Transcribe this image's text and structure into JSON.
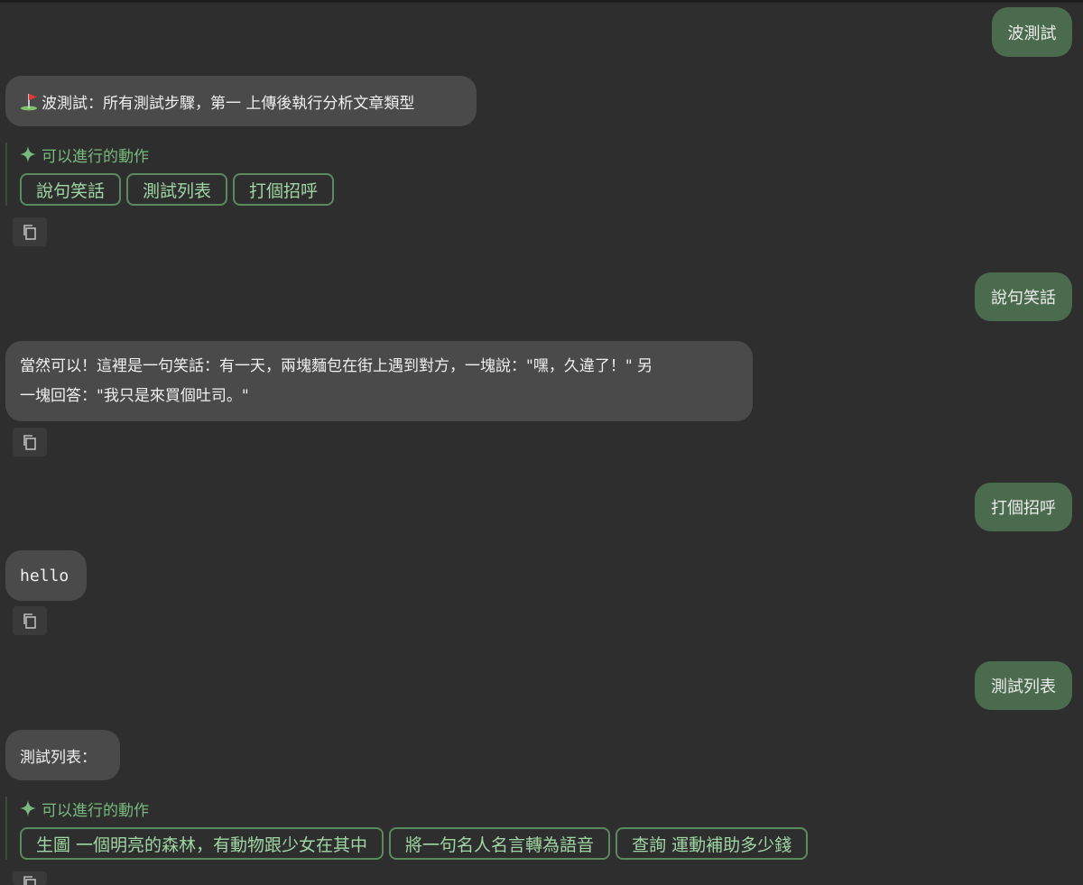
{
  "messages": {
    "m1_user": "波測試",
    "m1_bot": "波測試：所有測試步驟，第一  上傳後執行分析文章類型",
    "actions1": {
      "title": "可以進行的動作",
      "chips": [
        "說句笑話",
        "測試列表",
        "打個招呼"
      ]
    },
    "m2_user": "說句笑話",
    "m2_bot_line1": "當然可以！這裡是一句笑話：有一天，兩塊麵包在街上遇到對方，一塊說：\"嘿，久違了！\"  另",
    "m2_bot_line2": "一塊回答：\"我只是來買個吐司。\"",
    "m3_user": "打個招呼",
    "m3_bot": "hello",
    "m4_user": "測試列表",
    "m4_bot": "測試列表：",
    "actions2": {
      "title": "可以進行的動作",
      "chips": [
        "生圖 一個明亮的森林，有動物跟少女在其中",
        "將一句名人名言轉為語音",
        "查詢 運動補助多少錢"
      ]
    }
  },
  "icons": {
    "flag": "golf-flag-icon",
    "sparkle": "sparkle-icon",
    "copy": "copy-icon"
  },
  "colors": {
    "background": "#2e2e2e",
    "user_bubble": "#4a6b4d",
    "bot_bubble": "#4a4a4a",
    "accent_green": "#78b97d"
  }
}
